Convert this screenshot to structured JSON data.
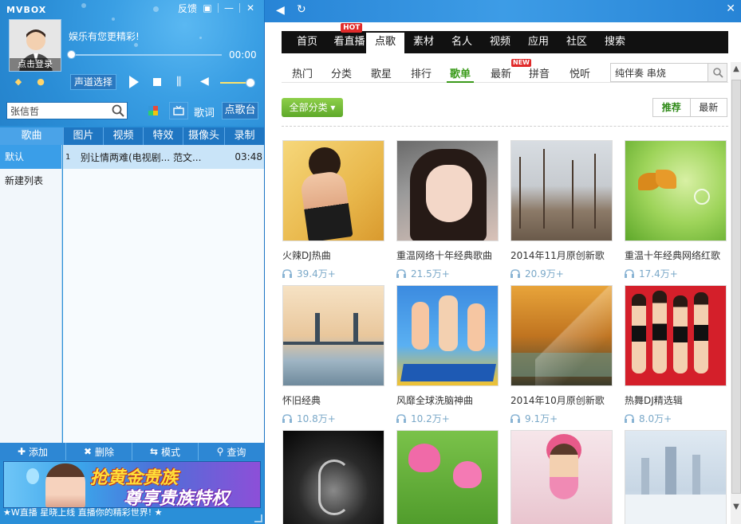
{
  "window": {
    "app_title": "MVBOX",
    "feedback_label": "反馈",
    "slogan": "娱乐有您更精彩!",
    "login_label": "点击登录"
  },
  "player": {
    "time": "00:00",
    "channel_label": "声道选择",
    "progress": 0,
    "volume": 0.9
  },
  "search": {
    "value": "张信哲",
    "lyrics_label": "歌词",
    "request_label": "点歌台"
  },
  "tabs": [
    {
      "label": "歌曲",
      "active": true
    },
    {
      "label": "图片"
    },
    {
      "label": "视频"
    },
    {
      "label": "特效"
    },
    {
      "label": "摄像头"
    },
    {
      "label": "录制"
    }
  ],
  "playlists": [
    {
      "label": "默认",
      "active": true
    },
    {
      "label": "新建列表"
    }
  ],
  "songs": [
    {
      "index": "1",
      "name": "别让情两难(电视剧... 范文...",
      "duration": "03:48"
    }
  ],
  "actions": [
    {
      "icon": "plus-icon",
      "label": "添加"
    },
    {
      "icon": "x-icon",
      "label": "删除"
    },
    {
      "icon": "loop-icon",
      "label": "模式"
    },
    {
      "icon": "search-icon",
      "label": "查询"
    }
  ],
  "banner": {
    "line1": "抢黄金贵族",
    "line2": "尊享贵族特权"
  },
  "marquee": "★W直播 星晓上线 直播你的精彩世界! ★",
  "browser": {
    "main_nav": [
      {
        "label": "首页"
      },
      {
        "label": "看直播",
        "badge": "HOT"
      },
      {
        "label": "点歌",
        "active": true
      },
      {
        "label": "素材"
      },
      {
        "label": "名人"
      },
      {
        "label": "视频"
      },
      {
        "label": "应用"
      },
      {
        "label": "社区"
      },
      {
        "label": "搜索"
      }
    ],
    "sub_nav": [
      {
        "label": "热门"
      },
      {
        "label": "分类"
      },
      {
        "label": "歌星"
      },
      {
        "label": "排行"
      },
      {
        "label": "歌单",
        "active": true
      },
      {
        "label": "最新",
        "badge": "NEW"
      },
      {
        "label": "拼音"
      },
      {
        "label": "悦听"
      }
    ],
    "filter_value": "纯伴奏 串烧",
    "all_categories_label": "全部分类",
    "sort": [
      {
        "label": "推荐",
        "active": true
      },
      {
        "label": "最新"
      }
    ]
  },
  "cards": [
    {
      "title": "火辣DJ热曲",
      "count": "39.4万+"
    },
    {
      "title": "重温网络十年经典歌曲",
      "count": "21.5万+"
    },
    {
      "title": "2014年11月原创新歌",
      "count": "20.9万+"
    },
    {
      "title": "重温十年经典网络红歌",
      "count": "17.4万+"
    },
    {
      "title": "怀旧经典",
      "count": "10.8万+"
    },
    {
      "title": "风靡全球洗脑神曲",
      "count": "10.2万+"
    },
    {
      "title": "2014年10月原创新歌",
      "count": "9.1万+"
    },
    {
      "title": "热舞DJ精选辑",
      "count": "8.0万+"
    },
    {
      "title": "",
      "count": ""
    },
    {
      "title": "",
      "count": ""
    },
    {
      "title": "",
      "count": ""
    },
    {
      "title": "",
      "count": ""
    }
  ],
  "colors": {
    "accent_blue": "#2a8fd8",
    "accent_green": "#3a9a1a",
    "hot_red": "#e02a2a"
  }
}
